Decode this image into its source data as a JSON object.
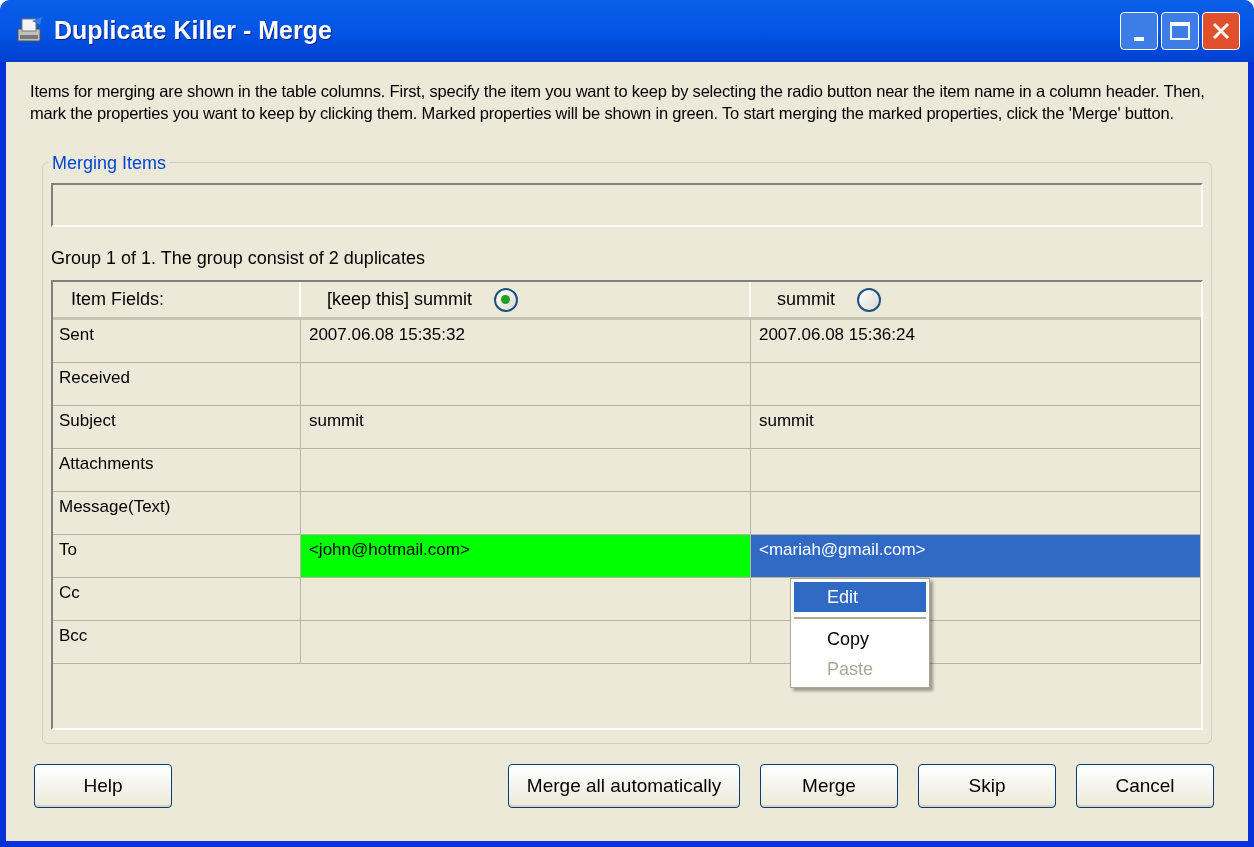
{
  "window": {
    "title": "Duplicate Killer - Merge"
  },
  "instructions": "Items for merging are shown in the table columns. First, specify the item you want to keep by selecting the radio button near the item name in a column header. Then, mark the properties you want to keep by clicking them. Marked properties will be shown in green. To start merging the marked properties, click the 'Merge' button.",
  "group_box": {
    "title": "Merging Items"
  },
  "group_info": "Group 1 of 1. The group consist of 2 duplicates",
  "table": {
    "field_header": "Item Fields:",
    "columns": [
      {
        "label": "[keep this] summit",
        "selected": true
      },
      {
        "label": "summit",
        "selected": false
      }
    ],
    "rows": [
      {
        "field": "Sent",
        "cells": [
          {
            "text": "2007.06.08 15:35:32",
            "marked": false,
            "selected": false
          },
          {
            "text": "2007.06.08 15:36:24",
            "marked": false,
            "selected": false
          }
        ]
      },
      {
        "field": "Received",
        "cells": [
          {
            "text": "",
            "marked": false,
            "selected": false
          },
          {
            "text": "",
            "marked": false,
            "selected": false
          }
        ]
      },
      {
        "field": "Subject",
        "cells": [
          {
            "text": "summit",
            "marked": false,
            "selected": false
          },
          {
            "text": "summit",
            "marked": false,
            "selected": false
          }
        ]
      },
      {
        "field": "Attachments",
        "cells": [
          {
            "text": "",
            "marked": false,
            "selected": false
          },
          {
            "text": "",
            "marked": false,
            "selected": false
          }
        ]
      },
      {
        "field": "Message(Text)",
        "cells": [
          {
            "text": "",
            "marked": false,
            "selected": false
          },
          {
            "text": "",
            "marked": false,
            "selected": false
          }
        ]
      },
      {
        "field": "To",
        "cells": [
          {
            "text": "<john@hotmail.com>",
            "marked": true,
            "selected": false
          },
          {
            "text": "<mariah@gmail.com>",
            "marked": false,
            "selected": true
          }
        ]
      },
      {
        "field": "Cc",
        "cells": [
          {
            "text": "",
            "marked": false,
            "selected": false
          },
          {
            "text": "",
            "marked": false,
            "selected": false
          }
        ]
      },
      {
        "field": "Bcc",
        "cells": [
          {
            "text": "",
            "marked": false,
            "selected": false
          },
          {
            "text": "",
            "marked": false,
            "selected": false
          }
        ]
      }
    ]
  },
  "context_menu": [
    {
      "kind": "item",
      "label": "Edit",
      "selected": true,
      "disabled": false
    },
    {
      "kind": "separator"
    },
    {
      "kind": "item",
      "label": "Copy",
      "selected": false,
      "disabled": false
    },
    {
      "kind": "item",
      "label": "Paste",
      "selected": false,
      "disabled": true
    }
  ],
  "buttons_left": [
    "Help"
  ],
  "buttons_right": [
    "Merge all automatically",
    "Merge",
    "Skip",
    "Cancel"
  ]
}
